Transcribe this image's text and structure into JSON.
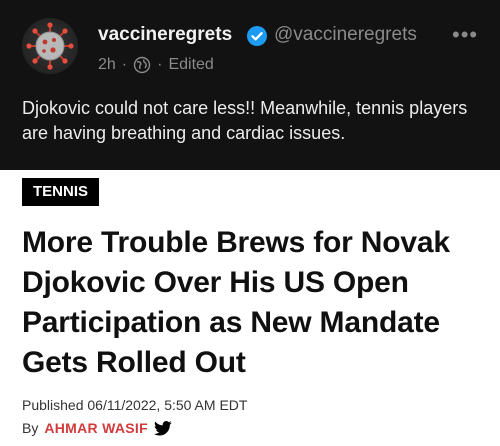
{
  "post": {
    "display_name": "vaccineregrets",
    "handle": "@vaccineregrets",
    "time": "2h",
    "separator": "·",
    "edited": "Edited",
    "more": "•••",
    "text": "Djokovic could not care less!! Meanwhile, tennis players are having breathing and cardiac issues.",
    "icons": {
      "avatar": "virus-avatar",
      "verified": "verified-badge-icon",
      "globe": "globe-icon",
      "more": "more-options-icon"
    },
    "colors": {
      "verified": "#1d9bf0"
    }
  },
  "article": {
    "tag": "TENNIS",
    "headline": "More Trouble Brews for Novak Djokovic Over His US Open Participation as New Mandate Gets Rolled Out",
    "published": "Published 06/11/2022, 5:50 AM EDT",
    "by_label": "By",
    "author": "AHMAR WASIF",
    "icons": {
      "twitter": "twitter-bird-icon"
    },
    "colors": {
      "author": "#d23b3b"
    }
  }
}
